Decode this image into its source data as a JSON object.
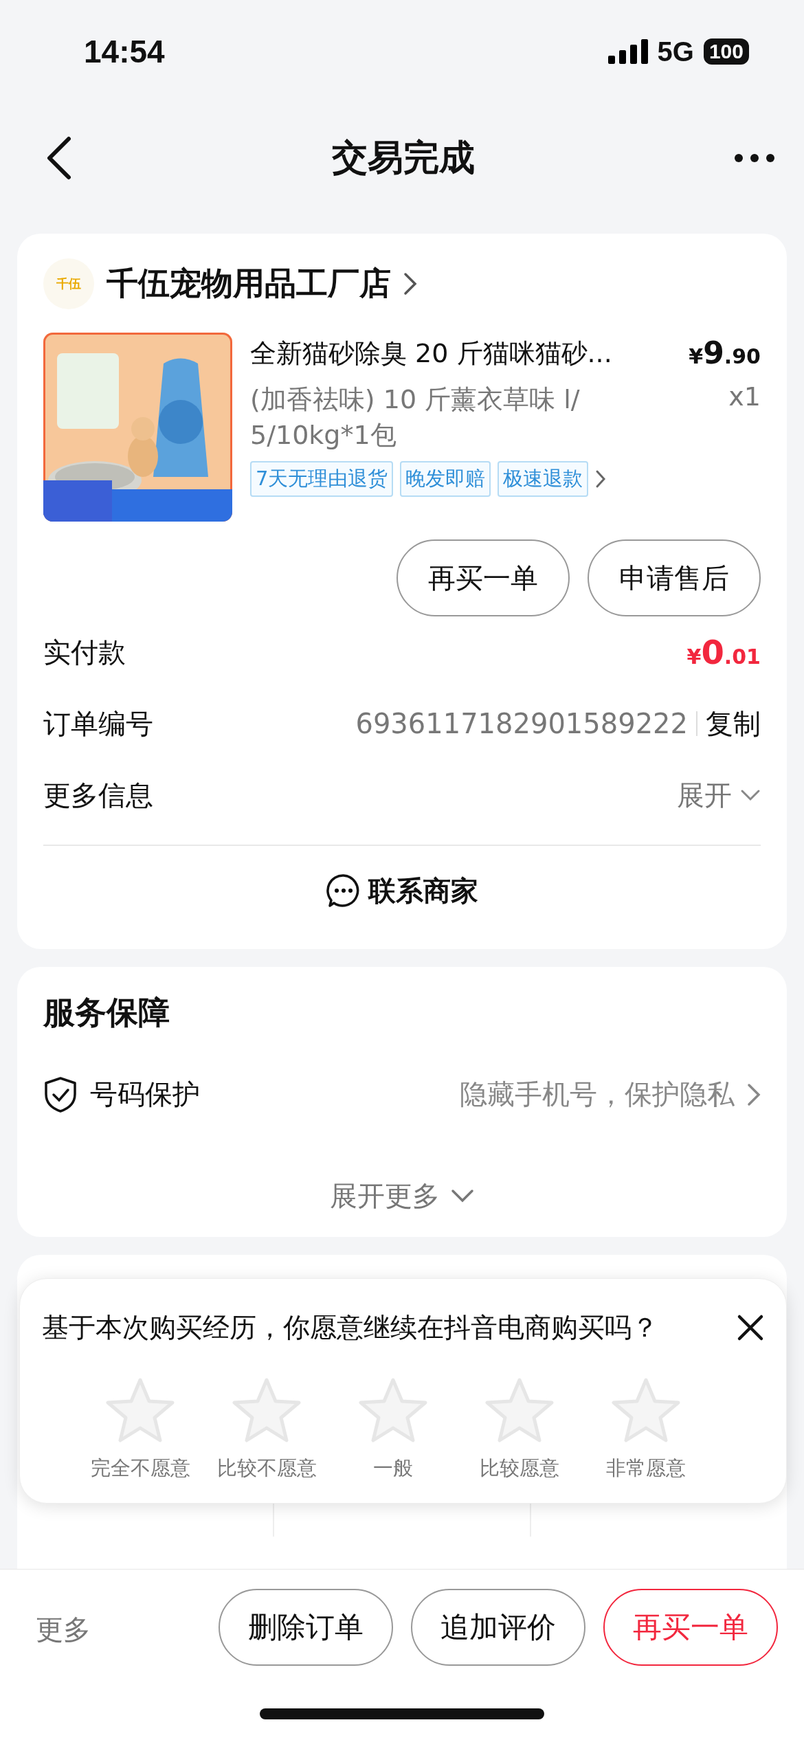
{
  "status_bar": {
    "time": "14:54",
    "network": "5G",
    "battery": "100"
  },
  "nav": {
    "title": "交易完成"
  },
  "order_card": {
    "shop": {
      "name": "千伍宠物用品工厂店",
      "logo_text": "千伍"
    },
    "product": {
      "kind": "picture",
      "title": "全新猫砂除臭 20 斤猫咪猫砂...",
      "spec": "(加香祛味) 10 斤薰衣草味 l/ 5/10kg*1包",
      "price_currency": "¥",
      "price_integer": "9",
      "price_decimal": ".90",
      "quantity": "x1",
      "tags": [
        "7天无理由退货",
        "晚发即赔",
        "极速退款"
      ]
    },
    "actions": [
      "再买一单",
      "申请售后"
    ],
    "rows": [
      {
        "kind": "amount",
        "label": "实付款",
        "currency": "¥",
        "integer": "0",
        "decimal": ".01"
      },
      {
        "kind": "copy",
        "label": "订单编号",
        "value": "6936117182901589222",
        "action": "复制"
      },
      {
        "kind": "expand",
        "label": "更多信息",
        "value": "展开",
        "expanded": false
      }
    ],
    "contact": "联系商家"
  },
  "service_card": {
    "title": "服务保障",
    "items": [
      {
        "label": "号码保护",
        "value": "隐藏手机号，保护隐私"
      }
    ],
    "more": "展开更多",
    "expanded": false
  },
  "survey": {
    "question": "基于本次购买经历，你愿意继续在抖音电商购买吗？",
    "stars": 0,
    "options": [
      "完全不愿意",
      "比较不愿意",
      "一般",
      "比较愿意",
      "非常愿意"
    ]
  },
  "bottom_bar": {
    "more": "更多",
    "buttons": [
      {
        "label": "删除订单",
        "primary": false
      },
      {
        "label": "追加评价",
        "primary": false
      },
      {
        "label": "再买一单",
        "primary": true
      }
    ]
  }
}
